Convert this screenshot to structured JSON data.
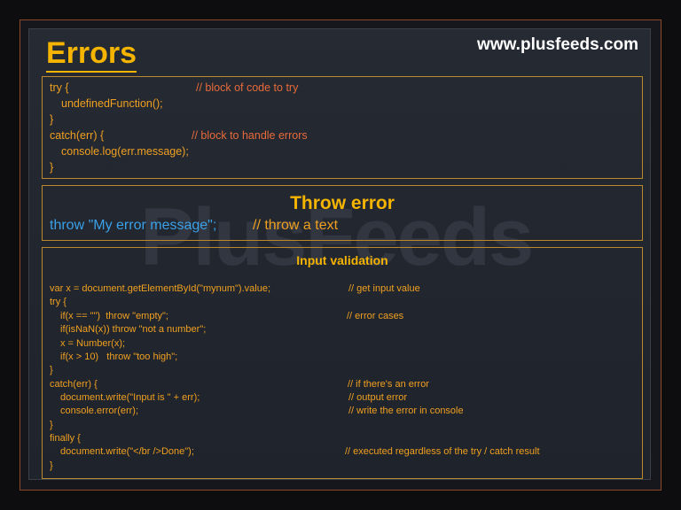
{
  "title": "Errors",
  "site": "www.plusfeeds.com",
  "watermark": "PlusFeeds",
  "block1": {
    "lines": [
      "try {",
      "undefinedFunction();",
      "}",
      "catch(err) {",
      "console.log(err.message);",
      "}"
    ],
    "comments": [
      "// block of code to try",
      "// block to handle errors"
    ]
  },
  "block2": {
    "heading": "Throw error",
    "code": "throw \"My error message\";",
    "comment": "// throw a text"
  },
  "block3": {
    "heading": "Input validation",
    "lines": [
      "var x = document.getElementById(\"mynum\").value;",
      "try {",
      "if(x == \"\")  throw \"empty\";",
      "if(isNaN(x)) throw \"not a number\";",
      "x = Number(x);",
      "if(x > 10)   throw \"too high\";",
      "}",
      "catch(err) {",
      "document.write(\"Input is \" + err);",
      "console.error(err);",
      "}",
      "finally {",
      "document.write(\"</br />Done\");",
      "}"
    ],
    "comments": [
      "// get input value",
      "// error cases",
      "// if there's an error",
      "// output error",
      "// write the error in console",
      "// executed regardless of the try / catch result"
    ]
  }
}
